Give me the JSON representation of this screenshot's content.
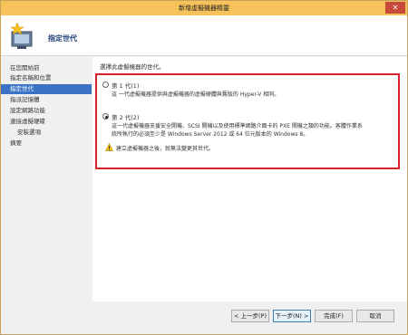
{
  "window": {
    "title": "新增虛擬機器精靈",
    "close_label": "✕"
  },
  "header": {
    "title": "指定世代"
  },
  "sidebar": {
    "items": [
      {
        "label": "在您開始前",
        "active": false,
        "sub": false
      },
      {
        "label": "指定名稱和位置",
        "active": false,
        "sub": false
      },
      {
        "label": "指定世代",
        "active": true,
        "sub": false
      },
      {
        "label": "指派記憶體",
        "active": false,
        "sub": false
      },
      {
        "label": "設定網路功能",
        "active": false,
        "sub": false
      },
      {
        "label": "連接虛擬硬碟",
        "active": false,
        "sub": false
      },
      {
        "label": "安裝選項",
        "active": false,
        "sub": true
      },
      {
        "label": "摘要",
        "active": false,
        "sub": false
      }
    ]
  },
  "content": {
    "prompt": "選擇此虛擬機器的世代。",
    "gen1": {
      "label": "第 1 代(1)",
      "selected": false,
      "desc": "這 一代虛擬機器提供與虛擬機器的虛擬硬體與舊版的 Hyper-V 相同。"
    },
    "gen2": {
      "label": "第 2 代(2)",
      "selected": true,
      "desc_line1": "這一代虛擬機器支援安全開機、SCSI 開機以及使用標準網路介面卡的 PXE 開機之類的功能。客體作業系",
      "desc_line2": "統所執行的必須至少是 Windows Server 2012 或 64 位元版本的 Windows 8。"
    },
    "warning": "建立虛擬機器之後，就無法變更其世代。"
  },
  "footer": {
    "prev": "< 上一步(P)",
    "next": "下一步(N) >",
    "finish": "完成(F)",
    "cancel": "取消"
  },
  "colors": {
    "titlebar": "#f7c25a",
    "highlight": "#d8232a",
    "active_nav": "#3a73c6",
    "header_title": "#1d3d78"
  }
}
